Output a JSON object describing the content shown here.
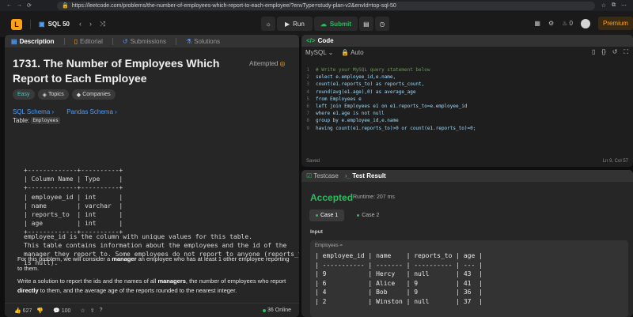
{
  "browser": {
    "url": "https://leetcode.com/problems/the-number-of-employees-which-report-to-each-employee/?envType=study-plan-v2&envId=top-sql-50",
    "back": "←",
    "forward": "→",
    "reload": "⟳",
    "ext_icons": [
      "☆",
      "⧉",
      "⋯"
    ]
  },
  "header": {
    "study_plan": "SQL 50",
    "run_label": "Run",
    "submit_label": "Submit",
    "streak": "0",
    "premium_label": "Premium"
  },
  "left": {
    "tabs": [
      {
        "label": "Description"
      },
      {
        "label": "Editorial"
      },
      {
        "label": "Submissions"
      },
      {
        "label": "Solutions"
      }
    ],
    "title": "1731. The Number of Employees Which Report to Each Employee",
    "attempted": "Attempted",
    "chips": {
      "difficulty": "Easy",
      "topics": "Topics",
      "companies": "Companies"
    },
    "sql_schema": "SQL Schema",
    "pandas_schema": "Pandas Schema",
    "table_label": "Table:",
    "table_name": "Employees",
    "schema_lines": [
      "+-------------+----------+",
      "| Column Name | Type     |",
      "+-------------+----------+",
      "| employee_id | int      |",
      "| name        | varchar  |",
      "| reports_to  | int      |",
      "| age         | int      |",
      "+-------------+----------+"
    ],
    "desc_lines": [
      "employee_id is the column with unique values for this table.",
      "This table contains information about the employees and the id of the",
      "manager they report to. Some employees do not report to anyone (reports_to",
      "is null)."
    ],
    "para1_a": "For this problem, we will consider a ",
    "para1_b": "manager",
    "para1_c": " an employee who has at least 1 other employee reporting to them.",
    "para2_a": "Write a solution to report the ids and the names of all ",
    "para2_b": "managers",
    "para2_c": ", the number of employees who report ",
    "para2_d": "directly",
    "para2_e": " to them, and the average age of the reports rounded to the nearest integer.",
    "likes": "627",
    "comments": "100",
    "online": "36 Online"
  },
  "code": {
    "title": "Code",
    "language": "MySQL",
    "auto": "Auto",
    "lines": [
      "# Write your MySQL query statement below",
      "select e.employee_id,e.name,",
      "count(e1.reports_to) as reports_count,",
      "round(avg(e1.age),0) as average_age",
      "from Employees e",
      "left join Employees e1 on e1.reports_to=e.employee_id",
      "where e1.age is not null",
      "group by e.employee_id,e.name",
      "having count(e1.reports_to)>0 or count(e1.reports_to)=0;"
    ],
    "line_numbers": [
      "1",
      "2",
      "3",
      "4",
      "5",
      "6",
      "7",
      "8",
      "9"
    ],
    "saved": "Saved",
    "position": "Ln 9, Col 57"
  },
  "result": {
    "testcase_tab": "Testcase",
    "result_tab": "Test Result",
    "status": "Accepted",
    "runtime": "Runtime: 207 ms",
    "case1": "Case 1",
    "case2": "Case 2",
    "input_label": "Input",
    "table_title": "Employees =",
    "table_lines": [
      "| employee_id | name    | reports_to | age |",
      "| ----------- | ------- | ---------- | --- |",
      "| 9           | Hercy   | null       | 43  |",
      "| 6           | Alice   | 9          | 41  |",
      "| 4           | Bob     | 9          | 36  |",
      "| 2           | Winston | null       | 37  |"
    ]
  },
  "colors": {
    "accent": "#ffa116",
    "success": "#2cbb5d",
    "link": "#4c9ffe"
  }
}
